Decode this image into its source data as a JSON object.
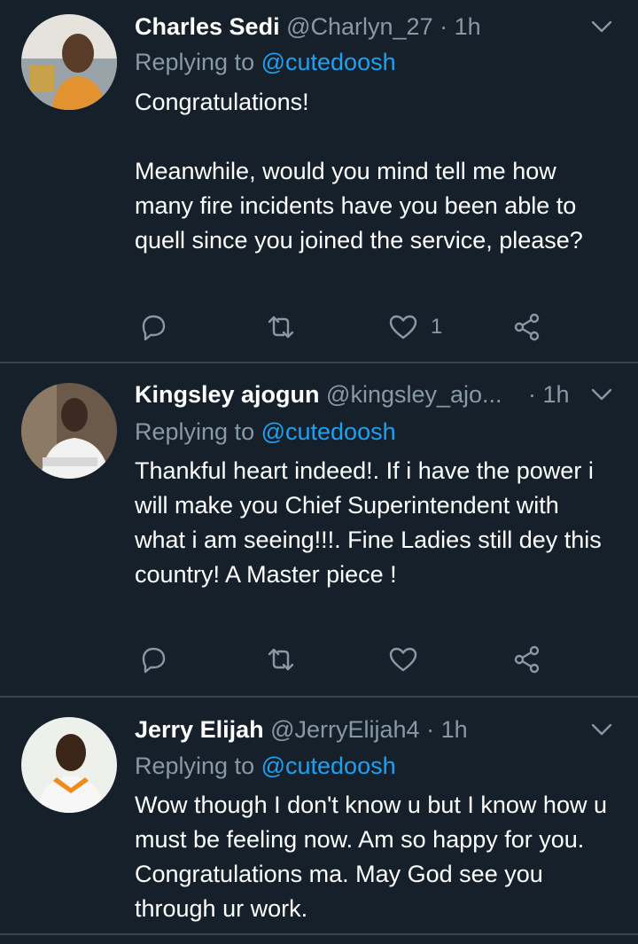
{
  "colors": {
    "background": "#15202b",
    "divider": "#38444d",
    "secondary_text": "#8899a6",
    "mention_blue": "#1da1f2"
  },
  "tweets": [
    {
      "name": "Charles Sedi",
      "handle": "@Charlyn_27",
      "dot": "·",
      "time": "1h",
      "replying_prefix": "Replying to ",
      "replying_to": "@cutedoosh",
      "text": "Congratulations!\n\nMeanwhile, would you mind tell me how many fire incidents have you been able to quell since you joined the service, please?",
      "like_count": "1",
      "icons": [
        "reply-icon",
        "retweet-icon",
        "like-icon",
        "share-icon",
        "chevron-down-icon"
      ]
    },
    {
      "name": "Kingsley ajogun",
      "handle": "@kingsley_ajo...",
      "dot": "·",
      "time": "1h",
      "replying_prefix": "Replying to ",
      "replying_to": "@cutedoosh",
      "text": "Thankful heart indeed!. If i have the power i will make you Chief Superintendent with what i am seeing!!!. Fine Ladies still dey this country! A Master piece !",
      "like_count": "",
      "icons": [
        "reply-icon",
        "retweet-icon",
        "like-icon",
        "share-icon",
        "chevron-down-icon"
      ]
    },
    {
      "name": "Jerry Elijah",
      "handle": "@JerryElijah4",
      "dot": "·",
      "time": "1h",
      "replying_prefix": "Replying to ",
      "replying_to": "@cutedoosh",
      "text": "Wow though I don't know u but I know how u must be feeling now. Am so happy for you. Congratulations ma. May God see you through ur work.",
      "icons": [
        "chevron-down-icon"
      ]
    }
  ]
}
